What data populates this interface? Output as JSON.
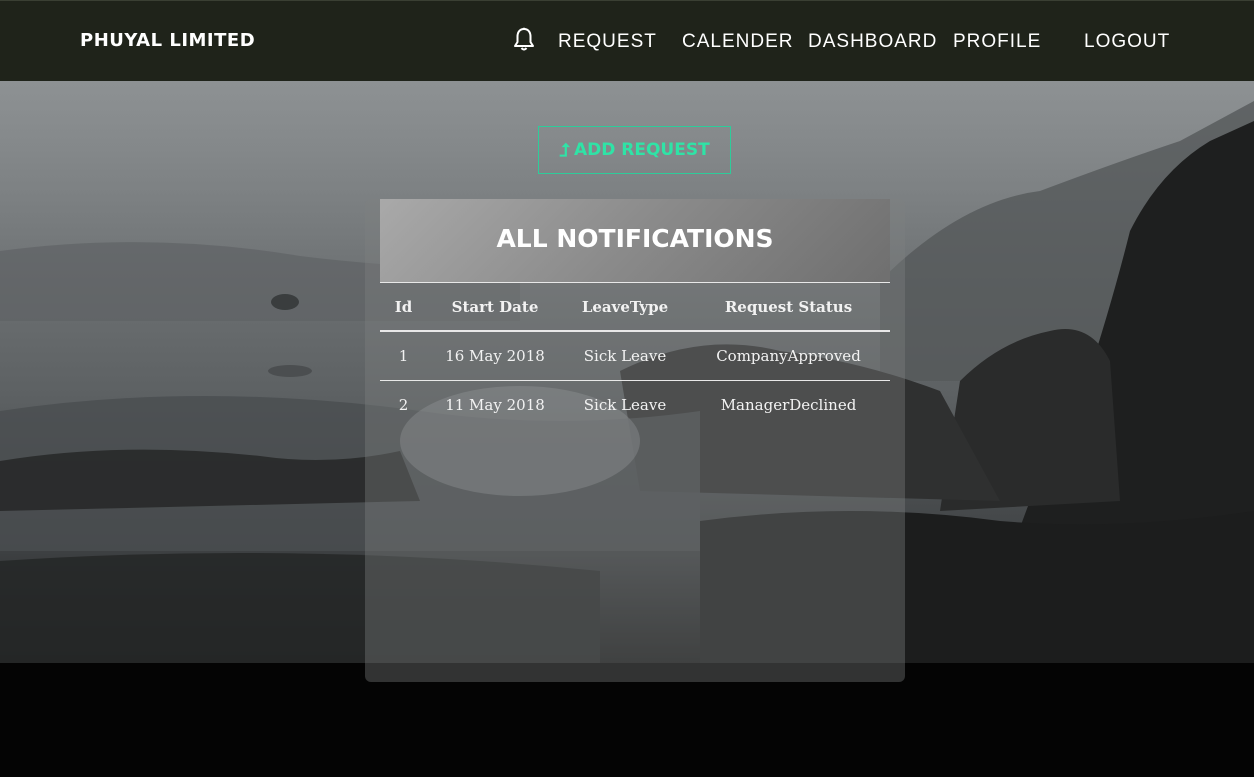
{
  "brand": "PHUYAL LIMITED",
  "nav": {
    "bell_icon": "bell-icon",
    "request": "REQUEST",
    "calender": "CALENDER",
    "dashboard": "DASHBOARD",
    "profile": "PROFILE",
    "logout": "LOGOUT"
  },
  "add_request": {
    "icon": "arrow-up-icon",
    "label": "ADD REQUEST"
  },
  "notifications": {
    "title": "ALL NOTIFICATIONS",
    "columns": [
      "Id",
      "Start Date",
      "LeaveType",
      "Request Status"
    ],
    "rows": [
      [
        "1",
        "16 May 2018",
        "Sick Leave",
        "CompanyApproved"
      ],
      [
        "2",
        "11 May 2018",
        "Sick Leave",
        "ManagerDeclined"
      ]
    ]
  },
  "colors": {
    "navbar": "#1f231a",
    "accent": "#2fe3a6",
    "page_bottom": "#040404"
  }
}
